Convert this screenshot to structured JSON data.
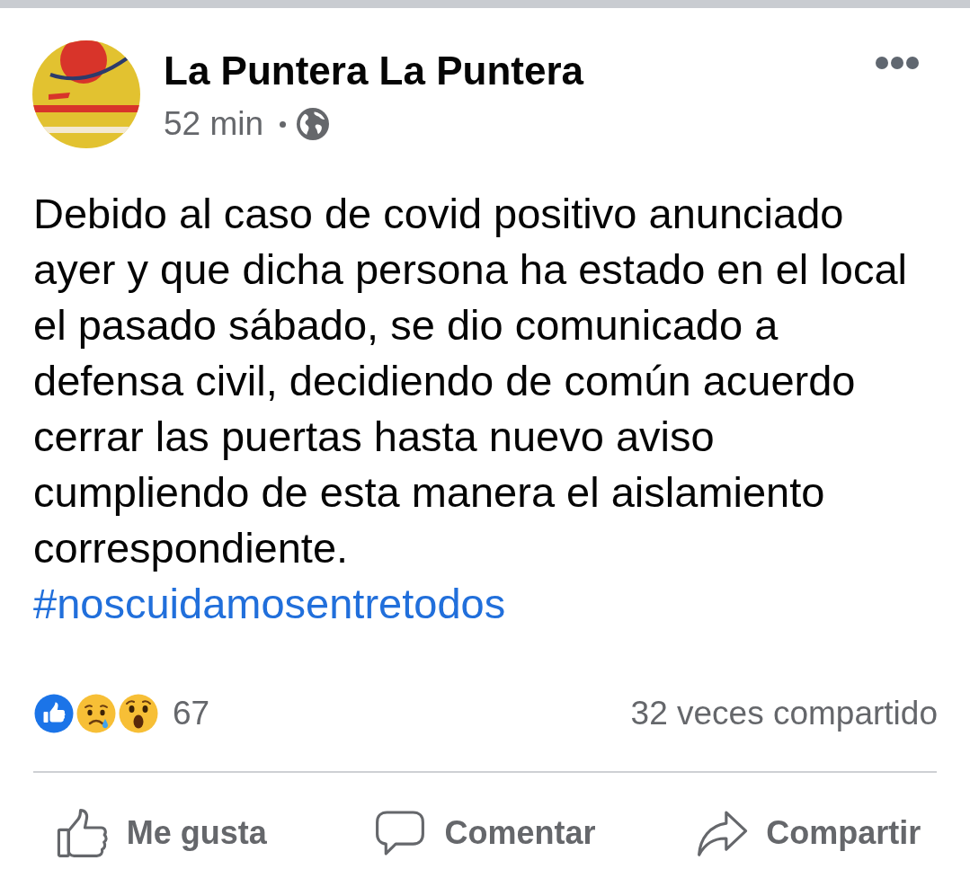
{
  "post": {
    "author": "La Puntera La Puntera",
    "time": "52 min",
    "text": "Debido al caso de covid positivo anunciado ayer y que dicha persona ha estado en el local el pasado sábado, se dio comunicado a defensa civil, decidiendo de común acuerdo cerrar las puertas hasta nuevo aviso cumpliendo de esta manera el aislamiento correspondiente.",
    "hashtag": "#noscuidamosentretodos"
  },
  "reactions": {
    "types": [
      {
        "kind": "like"
      },
      {
        "kind": "sad"
      },
      {
        "kind": "wow"
      }
    ],
    "count": "67",
    "shares": "32 veces compartido"
  },
  "actions": [
    {
      "kind": "like",
      "label": "Me gusta"
    },
    {
      "kind": "comment",
      "label": "Comentar"
    },
    {
      "kind": "share",
      "label": "Compartir"
    }
  ]
}
